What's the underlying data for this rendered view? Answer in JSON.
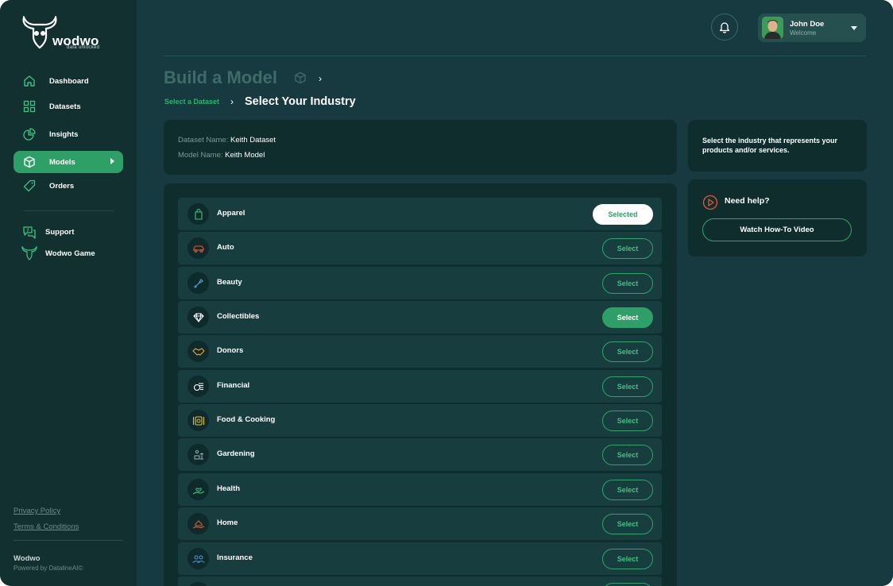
{
  "brand": {
    "name": "wodwo",
    "tagline": "data unlocked"
  },
  "sidebar": {
    "items": [
      {
        "label": "Dashboard"
      },
      {
        "label": "Datasets"
      },
      {
        "label": "Insights"
      },
      {
        "label": "Models"
      },
      {
        "label": "Orders"
      }
    ],
    "secondary": [
      {
        "label": "Support"
      },
      {
        "label": "Wodwo Game"
      }
    ],
    "footer": {
      "privacy": "Privacy Policy",
      "terms": "Terms & Conditions",
      "company": "Wodwo",
      "powered": "Powered by DatalineAI©"
    }
  },
  "header": {
    "user_name": "John Doe",
    "user_sub": "Welcome"
  },
  "page": {
    "title": "Build a Model",
    "breadcrumb_link": "Select a Dataset",
    "breadcrumb_current": "Select Your Industry"
  },
  "meta": {
    "dataset_label": "Dataset Name:",
    "dataset_value": "Keith Dataset",
    "model_label": "Model Name:",
    "model_value": "Keith Model"
  },
  "industries": [
    {
      "label": "Apparel",
      "button": "Selected"
    },
    {
      "label": "Auto",
      "button": "Select"
    },
    {
      "label": "Beauty",
      "button": "Select"
    },
    {
      "label": "Collectibles",
      "button": "Select"
    },
    {
      "label": "Donors",
      "button": "Select"
    },
    {
      "label": "Financial",
      "button": "Select"
    },
    {
      "label": "Food & Cooking",
      "button": "Select"
    },
    {
      "label": "Gardening",
      "button": "Select"
    },
    {
      "label": "Health",
      "button": "Select"
    },
    {
      "label": "Home",
      "button": "Select"
    },
    {
      "label": "Insurance",
      "button": "Select"
    },
    {
      "label": "",
      "button": ""
    }
  ],
  "side_panel": {
    "tip": "Select the industry that represents your products and/or services.",
    "help_title": "Need help?",
    "help_button": "Watch How-To Video"
  },
  "icons": {
    "dashboard": "home-icon",
    "datasets": "grid-icon",
    "insights": "pie-chart-icon",
    "models": "cube-icon",
    "orders": "tag-icon",
    "support": "chat-help-icon",
    "game": "bull-logo-icon",
    "bell": "bell-icon",
    "help": "play-circle-icon"
  },
  "colors": {
    "accent": "#2ea067",
    "accent_text": "#3ec281",
    "bg": "#163a40",
    "sidebar": "#12302f",
    "card": "#0f2d2d"
  }
}
